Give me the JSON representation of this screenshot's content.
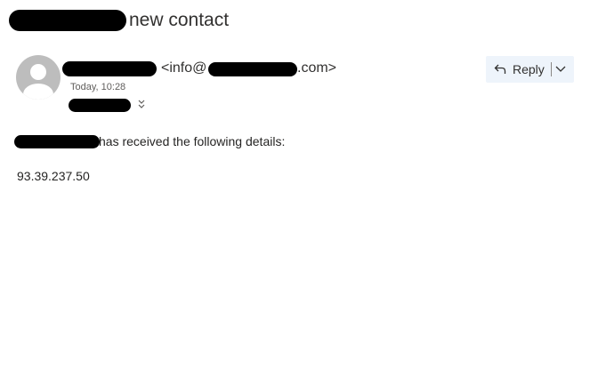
{
  "header": {
    "subject": "new contact"
  },
  "message": {
    "sender_email_prefix": "<info@",
    "sender_email_suffix": ".com>",
    "timestamp": "Today, 10:28",
    "body_line": "has received the following details:",
    "ip_address": "93.39.237.50"
  },
  "toolbar": {
    "reply_label": "Reply"
  },
  "icons": {
    "avatar": "person-icon",
    "reply": "reply-arrow-icon",
    "more": "chevron-down-icon",
    "expand": "double-chevron-down-icon"
  },
  "colors": {
    "reply_background": "#eef4fb",
    "avatar": "#bdbdbd",
    "redaction": "#000000"
  }
}
